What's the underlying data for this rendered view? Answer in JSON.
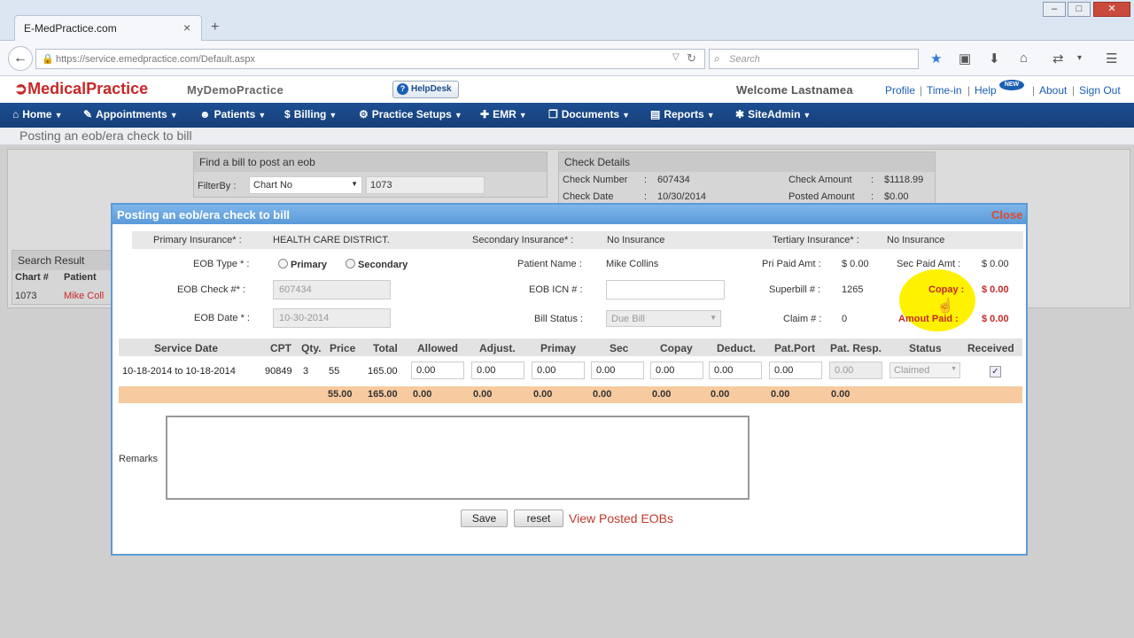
{
  "browser": {
    "tab_title": "E-MedPractice.com",
    "tab_close": "×",
    "new_tab": "+",
    "url": "https://service.emedpractice.com/Default.aspx",
    "search_placeholder": "Search"
  },
  "app": {
    "logo": "MedicalPractice",
    "practice": "MyDemoPractice",
    "helpdesk": "HelpDesk",
    "welcome": "Welcome Lastnamea",
    "links": [
      "Profile",
      "Time-in",
      "Help",
      "About",
      "Sign Out"
    ],
    "new_badge": "NEW"
  },
  "menu": [
    "Home",
    "Appointments",
    "Patients",
    "Billing",
    "Practice Setups",
    "EMR",
    "Documents",
    "Reports",
    "SiteAdmin"
  ],
  "page_title": "Posting an eob/era check to bill",
  "find_panel": {
    "title": "Find a bill to post an eob",
    "filter_label": "FilterBy :",
    "filter_value": "Chart No",
    "filter_input": "1073"
  },
  "check_details": {
    "title": "Check Details",
    "check_number_label": "Check Number",
    "check_number": "607434",
    "check_date_label": "Check Date",
    "check_date": "10/30/2014",
    "check_amount_label": "Check Amount",
    "check_amount": "$1118.99",
    "posted_amount_label": "Posted Amount",
    "posted_amount": "$0.00"
  },
  "search_result": {
    "title": "Search Result",
    "col_chart": "Chart #",
    "col_patient": "Patient",
    "chart": "1073",
    "patient": "Mike Coll"
  },
  "modal": {
    "title": "Posting an eob/era check to bill",
    "close": "Close",
    "primary_ins_label": "Primary Insurance* :",
    "primary_ins": "HEALTH CARE DISTRICT.",
    "secondary_ins_label": "Secondary Insurance* :",
    "secondary_ins": "No Insurance",
    "tertiary_ins_label": "Tertiary Insurance* :",
    "tertiary_ins": "No Insurance",
    "eob_type_label": "EOB Type * :",
    "eob_type_primary": "Primary",
    "eob_type_secondary": "Secondary",
    "eob_check_label": "EOB Check #* :",
    "eob_check": "607434",
    "eob_date_label": "EOB Date * :",
    "eob_date": "10-30-2014",
    "patient_name_label": "Patient Name :",
    "patient_name": "Mike Collins",
    "eob_icn_label": "EOB ICN # :",
    "eob_icn": "",
    "bill_status_label": "Bill Status :",
    "bill_status": "Due Bill",
    "pri_paid_label": "Pri Paid Amt :",
    "pri_paid": "$ 0.00",
    "sec_paid_label": "Sec Paid Amt :",
    "sec_paid": "$ 0.00",
    "superbill_label": "Superbill # :",
    "superbill": "1265",
    "copay_label": "Copay :",
    "copay": "$ 0.00",
    "claim_label": "Claim # :",
    "claim": "0",
    "amount_paid_label": "Amout Paid :",
    "amount_paid": "$ 0.00",
    "remarks_label": "Remarks",
    "save": "Save",
    "reset": "reset",
    "view_posted": "View Posted EOBs"
  },
  "grid": {
    "headers": [
      "Service Date",
      "CPT",
      "Qty.",
      "Price",
      "Total",
      "Allowed",
      "Adjust.",
      "Primay",
      "Sec",
      "Copay",
      "Deduct.",
      "Pat.Port",
      "Pat. Resp.",
      "Status",
      "Received"
    ],
    "row": {
      "service_date": "10-18-2014 to 10-18-2014",
      "cpt": "90849",
      "qty": "3",
      "price": "55",
      "total": "165.00",
      "allowed": "0.00",
      "adjust": "0.00",
      "primary": "0.00",
      "sec": "0.00",
      "copay": "0.00",
      "deduct": "0.00",
      "patport": "0.00",
      "patresp": "0.00",
      "status": "Claimed",
      "received": "✓"
    },
    "totals": [
      "55.00",
      "165.00",
      "0.00",
      "0.00",
      "0.00",
      "0.00",
      "0.00",
      "0.00",
      "0.00",
      "0.00"
    ]
  }
}
